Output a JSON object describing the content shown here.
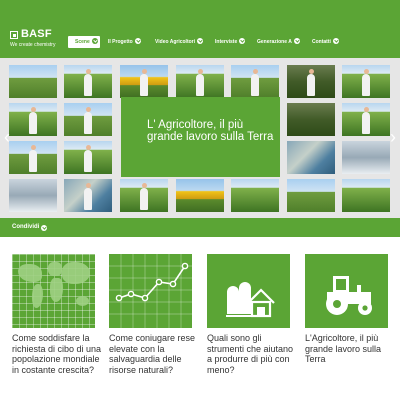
{
  "brand": {
    "name": "BASF",
    "tagline": "We create chemistry",
    "color": "#5ba535"
  },
  "nav": [
    {
      "label": "Scene",
      "active": true
    },
    {
      "label": "Il Progetto",
      "active": false
    },
    {
      "label": "Video Agricoltori",
      "active": false
    },
    {
      "label": "Interviste",
      "active": false
    },
    {
      "label": "Generazione A",
      "active": false
    },
    {
      "label": "Contatti",
      "active": false
    }
  ],
  "featured": {
    "title": "L' Agricoltore, il più grande lavoro sulla Terra"
  },
  "share": {
    "label": "Condividi"
  },
  "cards": [
    {
      "text": "Come soddisfare la richiesta di cibo di una popolazione mondiale in costante crescita?",
      "icon": "world-map-icon"
    },
    {
      "text": "Come coniugare rese elevate con la salvaguardia delle risorse naturali?",
      "icon": "line-chart-icon"
    },
    {
      "text": "Quali sono gli strumenti che aiutano a produrre di più con meno?",
      "icon": "farm-silo-icon"
    },
    {
      "text": "L'Agricoltore, il più grande lavoro sulla Terra",
      "icon": "tractor-icon"
    }
  ]
}
